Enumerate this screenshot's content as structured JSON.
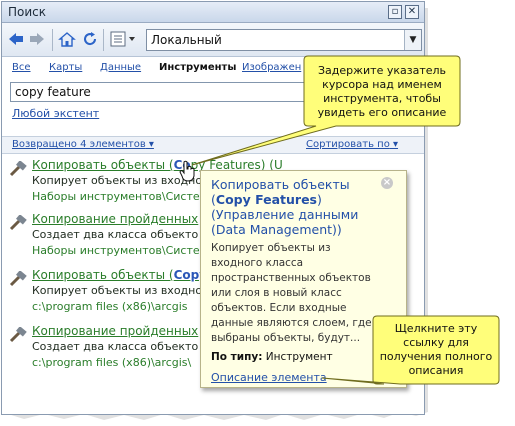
{
  "window": {
    "title": "Поиск"
  },
  "toolbar": {
    "catalog_value": "Локальный"
  },
  "tabs": [
    {
      "label": "Все",
      "active": false
    },
    {
      "label": "Карты",
      "active": false
    },
    {
      "label": "Данные",
      "active": false
    },
    {
      "label": "Инструменты",
      "active": true
    },
    {
      "label": "Изображен",
      "active": false
    }
  ],
  "search": {
    "value": "copy feature"
  },
  "extent_link": "Любой экстент",
  "results_bar": {
    "returned": "Возвращено 4 элементов",
    "sort": "Сортировать по"
  },
  "results": [
    {
      "title_main": "Копировать объекты (",
      "title_bold": "Co",
      "title_rest": "py Features) (U",
      "desc": "Копирует объекты из входно",
      "path": "Наборы инструментов\\Систем"
    },
    {
      "title_main": "Копирование пройденных",
      "title_bold": "",
      "title_rest": "",
      "desc": "Создает два класса объекто",
      "path": "Наборы инструментов\\Систем"
    },
    {
      "title_main": "Копировать объекты (",
      "title_bold": "Copy",
      "title_rest": "",
      "desc": "Копирует объекты из входно",
      "path": "c:\\program files (x86)\\arcgis"
    },
    {
      "title_main": "Копирование пройденных",
      "title_bold": "",
      "title_rest": "",
      "desc": "Создает два класса объекто",
      "path": "c:\\program files (x86)\\arcgis\\"
    }
  ],
  "tooltip": {
    "title_line1": "Копировать объекты",
    "title_bold": "Copy Features",
    "title_line3": "(Управление данными",
    "title_line4": "(Data Management))",
    "body_lines": [
      "Копирует объекты из",
      "входного класса",
      "пространственных объектов",
      "или слоя в новый класс",
      "объектов. Если входные",
      "данные являются слоем, где",
      "выбраны объекты, будут..."
    ],
    "type_label": "По типу:",
    "type_value": "Инструмент",
    "link": "Описание элемента"
  },
  "callouts": {
    "top_lines": [
      "Задержите указатель",
      "курсора над именем",
      "инструмента, чтобы",
      "увидеть его описание"
    ],
    "bottom_lines": [
      "Щелкните эту",
      "ссылку для",
      "получения полного",
      "описания"
    ]
  },
  "colors": {
    "callout_fill": "#fffe7a",
    "link": "#2350a8",
    "result_green": "#2a7d2a"
  }
}
